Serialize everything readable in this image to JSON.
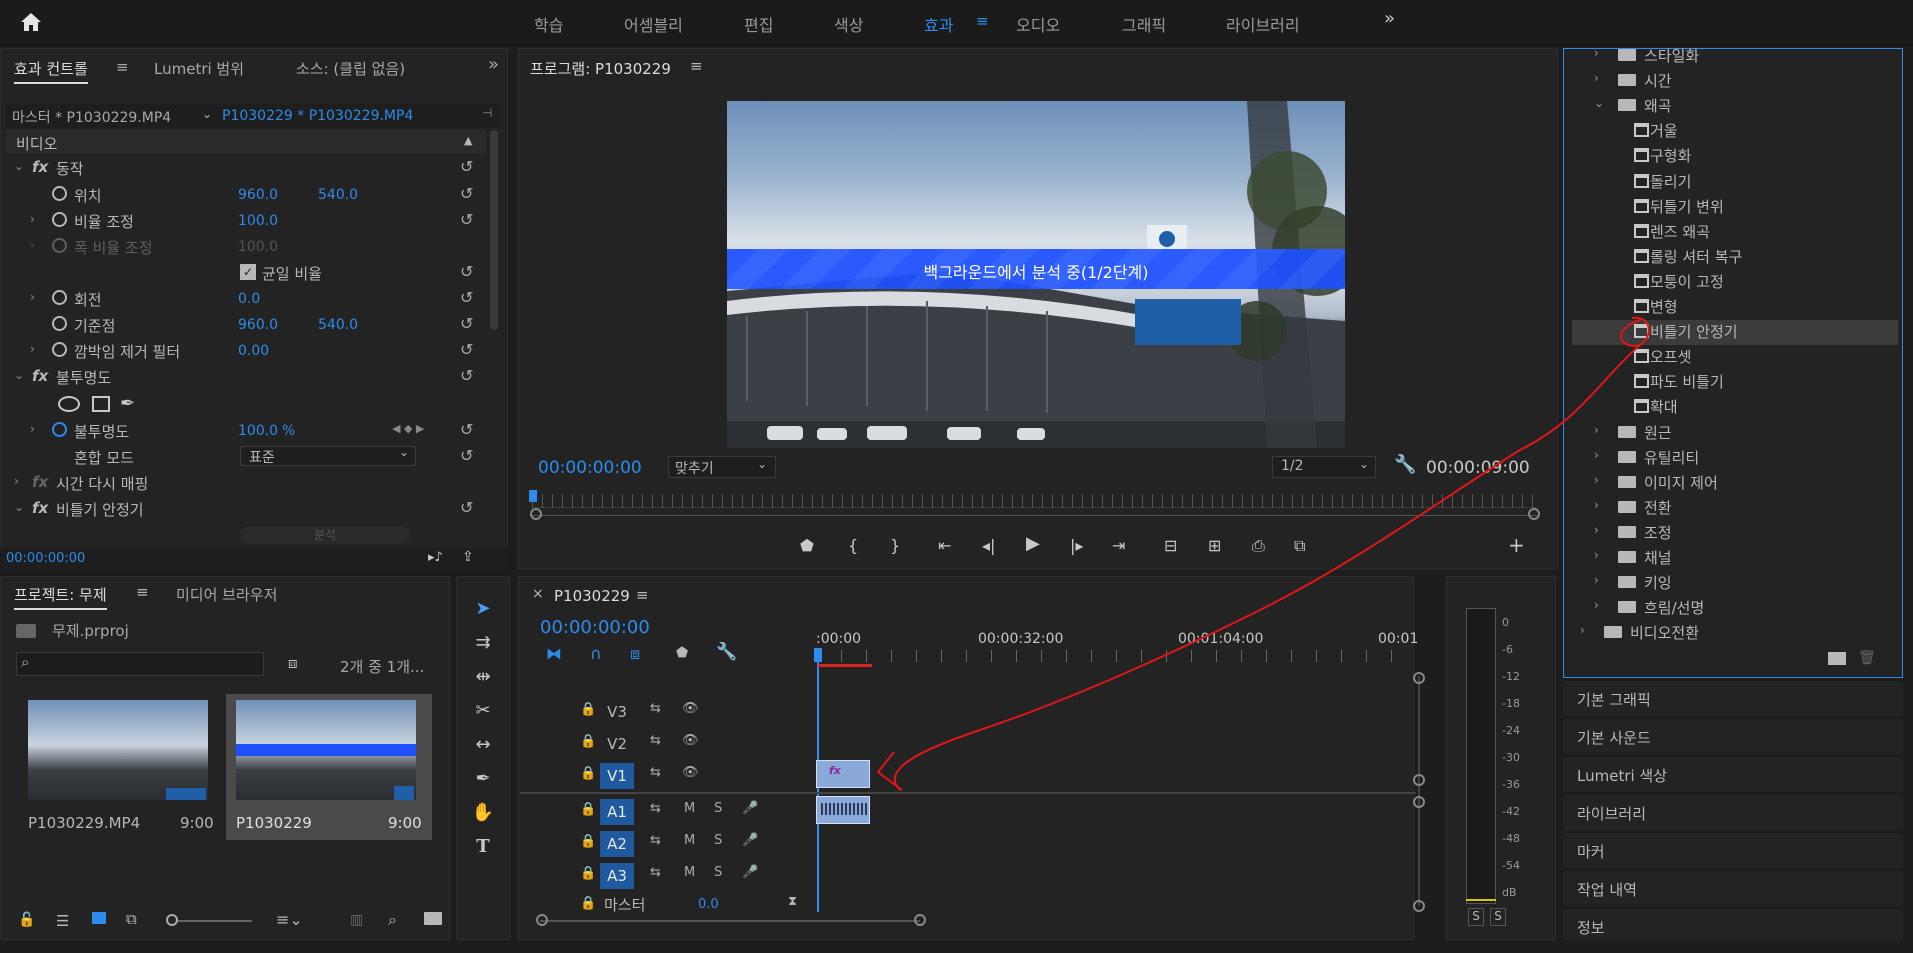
{
  "topbar": {
    "workspaces": [
      "학습",
      "어셈블리",
      "편집",
      "색상",
      "효과",
      "오디오",
      "그래픽",
      "라이브러리"
    ],
    "active": "효과",
    "overflow": "»"
  },
  "effect_controls": {
    "tabs": [
      "효과 컨트롤",
      "Lumetri 범위",
      "소스: (클립 없음)"
    ],
    "overflow": "»",
    "master_clip": "마스터 * P1030229.MP4",
    "sequence_clip": "P1030229 * P1030229.MP4",
    "section_video": "비디오",
    "rows": {
      "motion": "동작",
      "position": "위치",
      "position_x": "960.0",
      "position_y": "540.0",
      "scale": "비율 조정",
      "scale_val": "100.0",
      "scale_width": "폭 비율 조정",
      "scale_width_val": "100.0",
      "uniform": "균일 비율",
      "rotation": "회전",
      "rotation_val": "0.0",
      "anchor": "기준점",
      "anchor_x": "960.0",
      "anchor_y": "540.0",
      "flicker": "깜박임 제거 필터",
      "flicker_val": "0.00",
      "opacity": "불투명도",
      "opacity_prop": "불투명도",
      "opacity_val": "100.0",
      "opacity_unit": "%",
      "blend": "혼합 모드",
      "blend_val": "표준",
      "time_remap": "시간 다시 매핑",
      "stabilizer": "비틀기 안정기",
      "analyze": "분석"
    },
    "timecode": "00:00:00:00"
  },
  "program": {
    "title": "프로그램: P1030229",
    "overlay": "백그라운드에서 분석 중(1/2단계)",
    "timecode": "00:00:00:00",
    "fit": "맞추기",
    "resolution": "1/2",
    "duration": "00:00:09:00"
  },
  "project": {
    "tabs": [
      "프로젝트: 무제",
      "미디어 브라우저"
    ],
    "file": "무제.prproj",
    "count": "2개 중 1개...",
    "items": [
      {
        "name": "P1030229.MP4",
        "dur": "9:00"
      },
      {
        "name": "P1030229",
        "dur": "9:00"
      }
    ]
  },
  "timeline": {
    "title": "P1030229",
    "timecode": "00:00:00:00",
    "ruler": [
      ":00:00",
      "00:00:32:00",
      "00:01:04:00",
      "00:01"
    ],
    "video_tracks": [
      "V3",
      "V2",
      "V1"
    ],
    "audio_tracks": [
      "A1",
      "A2",
      "A3"
    ],
    "master": "마스터",
    "master_val": "0.0",
    "m": "M",
    "s": "S"
  },
  "meter": {
    "labels": [
      "0",
      "-6",
      "-12",
      "-18",
      "-24",
      "-30",
      "-36",
      "-42",
      "-48",
      "-54",
      "dB"
    ],
    "solo": "S"
  },
  "effects": {
    "items": [
      {
        "kind": "folder",
        "label": "스타일화",
        "indent": 0
      },
      {
        "kind": "folder",
        "label": "시간",
        "indent": 0
      },
      {
        "kind": "folder-open",
        "label": "왜곡",
        "indent": 0
      },
      {
        "kind": "fx",
        "label": "거울",
        "indent": 1
      },
      {
        "kind": "fx",
        "label": "구형화",
        "indent": 1
      },
      {
        "kind": "fx",
        "label": "돌리기",
        "indent": 1
      },
      {
        "kind": "fx",
        "label": "뒤틀기 변위",
        "indent": 1
      },
      {
        "kind": "fx",
        "label": "렌즈 왜곡",
        "indent": 1
      },
      {
        "kind": "fx",
        "label": "롤링 셔터 복구",
        "indent": 1
      },
      {
        "kind": "fx",
        "label": "모퉁이 고정",
        "indent": 1
      },
      {
        "kind": "fx",
        "label": "변형",
        "indent": 1
      },
      {
        "kind": "fx",
        "label": "비틀기 안정기",
        "indent": 1
      },
      {
        "kind": "fx",
        "label": "오프셋",
        "indent": 1
      },
      {
        "kind": "fx",
        "label": "파도 비틀기",
        "indent": 1
      },
      {
        "kind": "fx",
        "label": "확대",
        "indent": 1
      },
      {
        "kind": "folder",
        "label": "원근",
        "indent": 0
      },
      {
        "kind": "folder",
        "label": "유틸리티",
        "indent": 0
      },
      {
        "kind": "folder",
        "label": "이미지 제어",
        "indent": 0
      },
      {
        "kind": "folder",
        "label": "전환",
        "indent": 0
      },
      {
        "kind": "folder",
        "label": "조정",
        "indent": 0
      },
      {
        "kind": "folder",
        "label": "채널",
        "indent": 0
      },
      {
        "kind": "folder",
        "label": "키잉",
        "indent": 0
      },
      {
        "kind": "folder",
        "label": "흐림/선명",
        "indent": 0
      },
      {
        "kind": "folder",
        "label": "비디오전환",
        "indent": -1
      }
    ],
    "selected": "비틀기 안정기"
  },
  "side_panels": [
    "기본 그래픽",
    "기본 사운드",
    "Lumetri 색상",
    "라이브러리",
    "마커",
    "작업 내역",
    "정보"
  ],
  "colors": {
    "accent": "#2d8ceb",
    "annotation": "#e0161a",
    "overlay_band": "#1e50ff"
  }
}
